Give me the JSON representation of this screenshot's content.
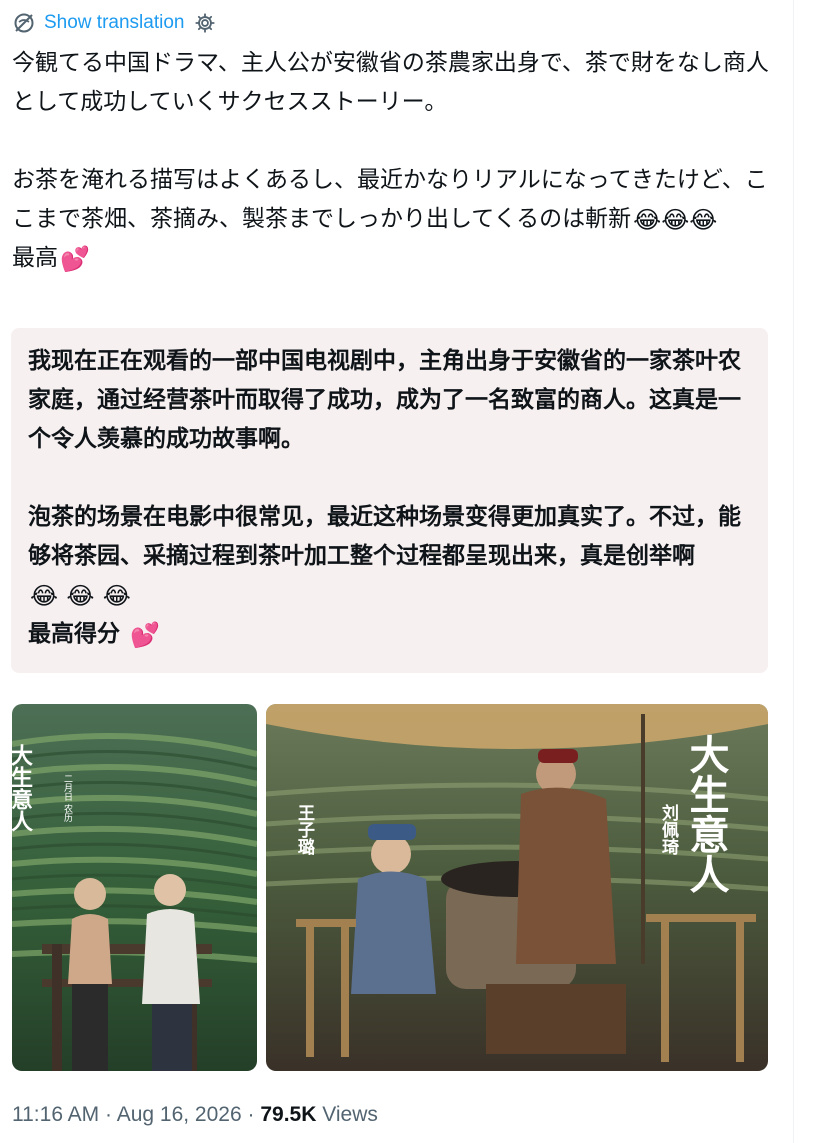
{
  "translation_bar": {
    "link": "Show translation"
  },
  "original_text": "今観てる中国ドラマ、主人公が安徽省の茶農家出身で、茶で財をなし商人として成功していくサクセスストーリー。\n\nお茶を淹れる描写はよくあるし、最近かなりリアルになってきたけど、ここまで茶畑、茶摘み、製茶までしっかり出してくるのは斬新",
  "original_emojis": "😂😂😂",
  "original_last": "最高",
  "translated_text": "我现在正在观看的一部中国电视剧中，主角出身于安徽省的一家茶叶农家庭，通过经营茶叶而取得了成功，成为了一名致富的商人。这真是一个令人羡慕的成功故事啊。\n\n泡茶的场景在电影中很常见，最近这种场景变得更加真实了。不过，能够将茶园、采摘过程到茶叶加工整个过程都呈现出来，真是创举啊",
  "translated_emojis": "😂 😂 😂",
  "translated_last": "最高得分",
  "heart": "💕",
  "images": {
    "left": {
      "title": "大生意人",
      "side_text": "二月日 农历"
    },
    "right": {
      "title": "大生意人",
      "actor1": "王子璐",
      "actor2": "刘佩琦"
    }
  },
  "footer": {
    "time": "11:16 AM",
    "sep": "·",
    "date": "Aug 16, 2026",
    "views_count": "79.5K",
    "views_label": "Views"
  },
  "colors": {
    "link": "#1d9bf0",
    "translation_bg": "#f7f0f0",
    "meta": "#536471"
  }
}
